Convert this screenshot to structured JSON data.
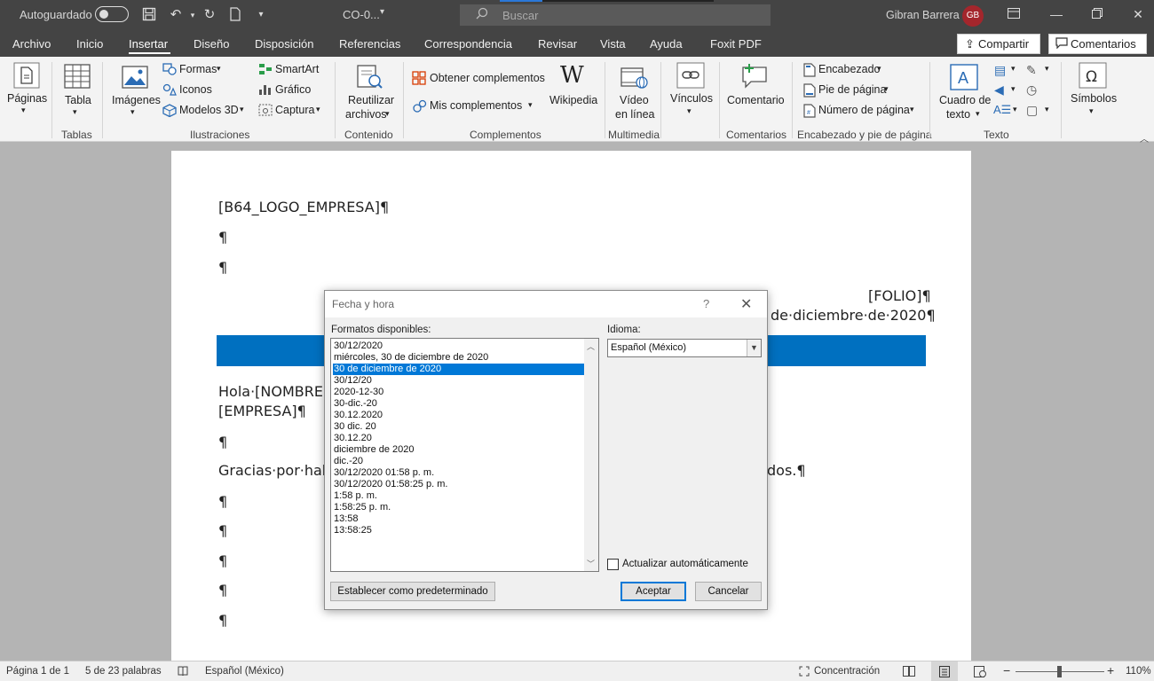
{
  "titlebar": {
    "autosave_label": "Autoguardado",
    "doc_title": "CO-0...",
    "search_placeholder": "Buscar",
    "user_name": "Gibran Barrera",
    "user_initials": "GB"
  },
  "menu": {
    "tabs": [
      "Archivo",
      "Inicio",
      "Insertar",
      "Diseño",
      "Disposición",
      "Referencias",
      "Correspondencia",
      "Revisar",
      "Vista",
      "Ayuda",
      "Foxit PDF"
    ],
    "active_tab": "Insertar",
    "share_label": "Compartir",
    "comments_label": "Comentarios"
  },
  "ribbon": {
    "paginas": "Páginas",
    "tabla": "Tabla",
    "imagenes": "Imágenes",
    "formas": "Formas",
    "iconos": "Iconos",
    "modelos3d": "Modelos 3D",
    "smartart": "SmartArt",
    "grafico": "Gráfico",
    "captura": "Captura",
    "reutilizar1": "Reutilizar",
    "reutilizar2": "archivos",
    "obtener": "Obtener complementos",
    "mis": "Mis complementos",
    "wikipedia": "Wikipedia",
    "video1": "Vídeo",
    "video2": "en línea",
    "vinculos": "Vínculos",
    "comentario": "Comentario",
    "encabezado": "Encabezado",
    "pie": "Pie de página",
    "numero": "Número de página",
    "cuadro1": "Cuadro de",
    "cuadro2": "texto",
    "simbolos": "Símbolos",
    "groups": {
      "tablas": "Tablas",
      "ilustraciones": "Ilustraciones",
      "contenido": "Contenido",
      "complementos": "Complementos",
      "multimedia": "Multimedia",
      "comentarios": "Comentarios",
      "encabezado_pie": "Encabezado y pie de página",
      "texto": "Texto"
    }
  },
  "document": {
    "logo_placeholder": "[B64_LOGO_EMPRESA]¶",
    "pilcrow": "¶",
    "folio": "[FOLIO]¶",
    "date_line": "de·diciembre·de·2020¶",
    "greeting": "Hola·[NOMBRE",
    "empresa": "[EMPRESA]¶",
    "thanks_start": "Gracias·por·hab",
    "thanks_end": "dos.¶"
  },
  "dialog": {
    "title": "Fecha y hora",
    "help": "?",
    "formats_label": "Formatos disponibles:",
    "formats": [
      "30/12/2020",
      "miércoles, 30 de diciembre de 2020",
      "30 de diciembre de 2020",
      "30/12/20",
      "2020-12-30",
      "30-dic.-20",
      "30.12.2020",
      "30 dic. 20",
      "30.12.20",
      "diciembre de 2020",
      "dic.-20",
      "30/12/2020 01:58 p. m.",
      "30/12/2020 01:58:25 p. m.",
      "1:58 p. m.",
      "1:58:25 p. m.",
      "13:58",
      "13:58:25"
    ],
    "selected_index": 2,
    "language_label": "Idioma:",
    "language_value": "Español (México)",
    "auto_update_label": "Actualizar automáticamente",
    "auto_update_checked": false,
    "set_default_label": "Establecer como predeterminado",
    "ok_label": "Aceptar",
    "cancel_label": "Cancelar"
  },
  "statusbar": {
    "page": "Página 1 de 1",
    "words": "5 de 23 palabras",
    "language": "Español (México)",
    "focus": "Concentración",
    "zoom_out": "−",
    "zoom_in": "+",
    "zoom": "110%"
  },
  "colors": {
    "titlebar": "#444444",
    "accent": "#0078d7",
    "header_bar": "#0070c0",
    "avatar": "#a4262c"
  }
}
